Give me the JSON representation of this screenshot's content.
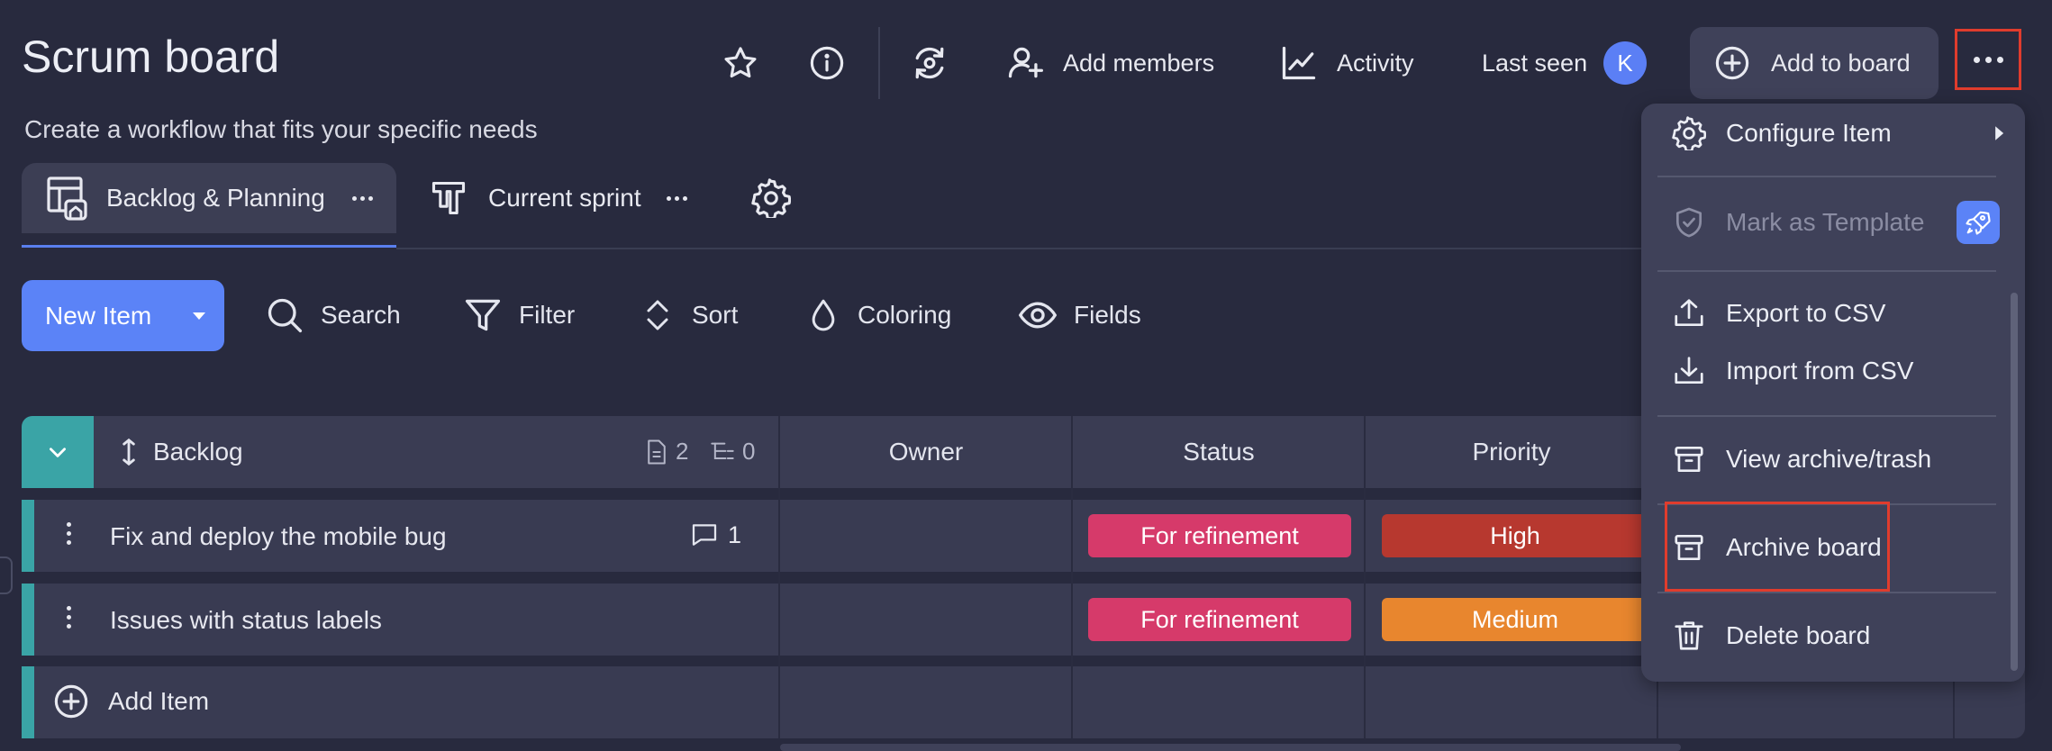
{
  "header": {
    "title": "Scrum board",
    "subtitle": "Create a workflow that fits your specific needs",
    "add_members_label": "Add members",
    "activity_label": "Activity",
    "last_seen_label": "Last seen",
    "avatar_initial": "K",
    "add_to_board_label": "Add to board"
  },
  "views": {
    "tabs": [
      {
        "label": "Backlog & Planning",
        "active": true
      },
      {
        "label": "Current sprint",
        "active": false
      }
    ]
  },
  "toolbar": {
    "new_item_label": "New Item",
    "search_label": "Search",
    "filter_label": "Filter",
    "sort_label": "Sort",
    "coloring_label": "Coloring",
    "fields_label": "Fields"
  },
  "table": {
    "group": {
      "name": "Backlog",
      "item_count": "2",
      "subitem_count": "0"
    },
    "columns": [
      "Owner",
      "Status",
      "Priority"
    ],
    "rows": [
      {
        "title": "Fix and deploy the mobile bug",
        "comments": "1",
        "status": "For refinement",
        "priority": "High"
      },
      {
        "title": "Issues with status labels",
        "comments": "",
        "status": "For refinement",
        "priority": "Medium"
      }
    ],
    "add_item_label": "Add Item"
  },
  "menu": {
    "items": [
      {
        "label": "Configure Item"
      },
      {
        "label": "Mark as Template"
      },
      {
        "label": "Export to CSV"
      },
      {
        "label": "Import from CSV"
      },
      {
        "label": "View archive/trash"
      },
      {
        "label": "Archive board"
      },
      {
        "label": "Delete board"
      }
    ]
  },
  "colors": {
    "background": "#282a3e",
    "accent": "#5b83f7",
    "teal": "#3aa4a6",
    "status_refinement": "#d63a6a",
    "priority_high": "#b7382f",
    "priority_medium": "#e8862e",
    "highlight": "#e03c2d"
  },
  "icons": [
    "star-icon",
    "info-icon",
    "sync-icon",
    "add-user-icon",
    "activity-icon",
    "plus-circle-icon",
    "more-icon",
    "board-home-icon",
    "columns-icon",
    "gear-icon",
    "search-icon",
    "filter-icon",
    "sort-icon",
    "drop-icon",
    "eye-icon",
    "chevron-down-icon",
    "drag-icon",
    "document-icon",
    "subitems-icon",
    "comment-icon",
    "shield-icon",
    "rocket-icon",
    "upload-icon",
    "download-icon",
    "archive-icon",
    "trash-icon",
    "chevron-right-icon"
  ]
}
